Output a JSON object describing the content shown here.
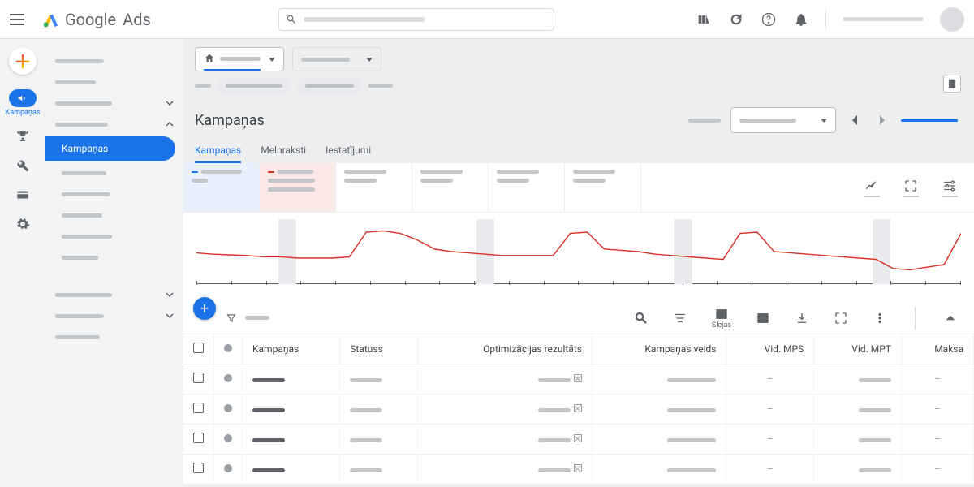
{
  "header": {
    "brand_a": "Google",
    "brand_b": "Ads"
  },
  "rail": {
    "campaigns_label": "Kampaņas"
  },
  "nav": {
    "selected_label": "Kampaņas"
  },
  "page": {
    "title": "Kampaņas"
  },
  "tabs": [
    {
      "label": "Kampaņas",
      "active": true
    },
    {
      "label": "Melnraksti",
      "active": false
    },
    {
      "label": "Iestatījumi",
      "active": false
    }
  ],
  "toolbar": {
    "columns_label": "Slejas"
  },
  "table": {
    "headers": {
      "campaigns": "Kampaņas",
      "status": "Statuss",
      "optimization": "Optimizācijas rezultāts",
      "type": "Kampaņas veids",
      "avg_mps": "Vid. MPS",
      "avg_mpt": "Vid. MPT",
      "cost": "Maksa"
    },
    "rows": [
      {
        "mps": "–",
        "cost": "–"
      },
      {
        "mps": "–",
        "cost": "–"
      },
      {
        "mps": "–",
        "cost": "–"
      },
      {
        "mps": "–",
        "cost": "–"
      }
    ]
  },
  "chart_data": {
    "type": "line",
    "title": "",
    "series": [
      {
        "name": "red",
        "color": "#d93025",
        "values": [
          48,
          46,
          45,
          44,
          42,
          42,
          40,
          40,
          40,
          42,
          80,
          82,
          78,
          68,
          54,
          50,
          48,
          46,
          44,
          44,
          44,
          44,
          78,
          80,
          54,
          52,
          50,
          46,
          44,
          42,
          40,
          38,
          78,
          80,
          50,
          48,
          46,
          44,
          42,
          40,
          38,
          24,
          22,
          26,
          30,
          78
        ]
      }
    ],
    "bands": [
      0.11,
      0.375,
      0.64,
      0.905
    ],
    "xlabel": "",
    "ylabel": "",
    "ylim": [
      0,
      100
    ]
  }
}
